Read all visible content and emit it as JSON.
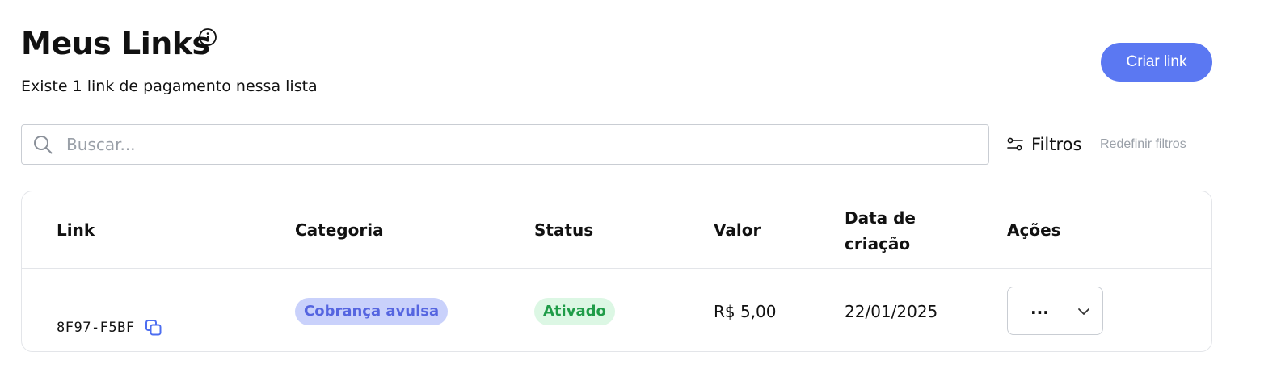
{
  "header": {
    "title": "Meus Links",
    "subtitle": "Existe 1 link de pagamento nessa lista",
    "create_button_label": "Criar link"
  },
  "toolbar": {
    "search_placeholder": "Buscar...",
    "filters_label": "Filtros",
    "reset_filters_label": "Redefinir filtros"
  },
  "table": {
    "columns": {
      "link": "Link",
      "category": "Categoria",
      "status": "Status",
      "value": "Valor",
      "created_date": "Data de criação",
      "actions": "Ações"
    },
    "rows": [
      {
        "link_id": "8F97-F5BF",
        "category": "Cobrança avulsa",
        "status": "Ativado",
        "value": "R$ 5,00",
        "created_date": "22/01/2025",
        "actions_value": "..."
      }
    ]
  },
  "colors": {
    "accent": "#5b78f2",
    "category_badge_bg": "#c9d1fb",
    "category_badge_text": "#5565e0",
    "status_badge_bg": "#dcf7e4",
    "status_badge_text": "#1f9c48"
  },
  "icons": {
    "info": "info-icon",
    "search": "search-icon",
    "filters": "sliders-icon",
    "copy": "copy-icon",
    "chevron": "chevron-down-icon"
  }
}
